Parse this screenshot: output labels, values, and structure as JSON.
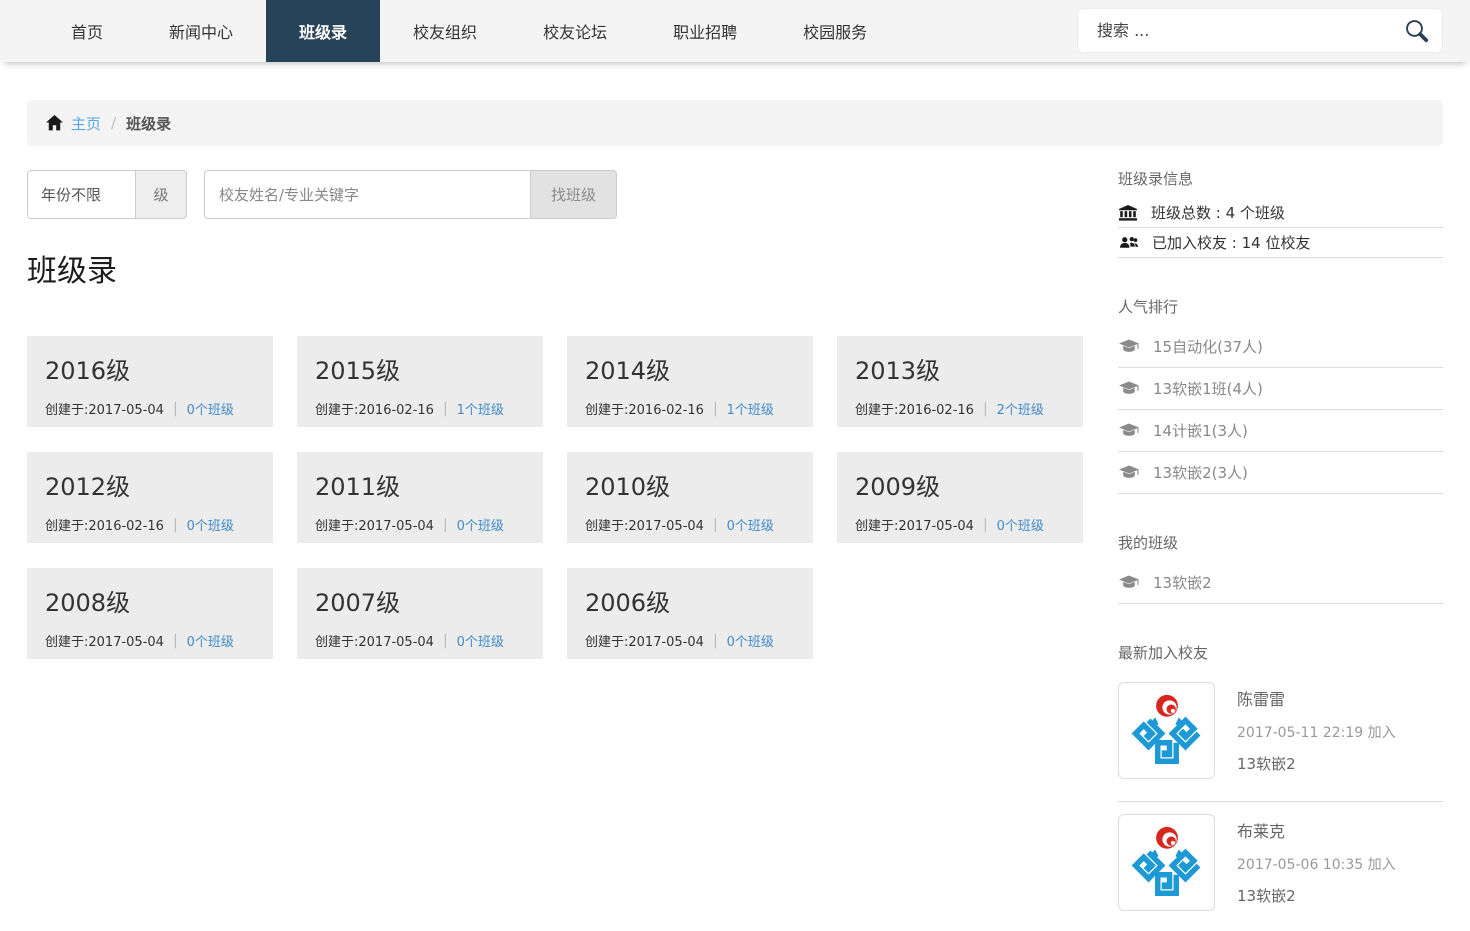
{
  "nav": {
    "items": [
      {
        "label": "首页",
        "active": false
      },
      {
        "label": "新闻中心",
        "active": false
      },
      {
        "label": "班级录",
        "active": true
      },
      {
        "label": "校友组织",
        "active": false
      },
      {
        "label": "校友论坛",
        "active": false
      },
      {
        "label": "职业招聘",
        "active": false
      },
      {
        "label": "校园服务",
        "active": false
      }
    ],
    "search_placeholder": "搜索 ...",
    "search_icon": "search-icon"
  },
  "breadcrumb": {
    "home_icon": "home-icon",
    "home": "主页",
    "separator": "/",
    "current": "班级录"
  },
  "filter": {
    "year_select": "年份不限",
    "year_suffix": "级",
    "keyword_placeholder": "校友姓名/专业关键字",
    "submit": "找班级"
  },
  "page_title": "班级录",
  "cards": [
    {
      "year": "2016级",
      "created": "创建于:2017-05-04",
      "sep": "|",
      "link": "0个班级"
    },
    {
      "year": "2015级",
      "created": "创建于:2016-02-16",
      "sep": "|",
      "link": "1个班级"
    },
    {
      "year": "2014级",
      "created": "创建于:2016-02-16",
      "sep": "|",
      "link": "1个班级"
    },
    {
      "year": "2013级",
      "created": "创建于:2016-02-16",
      "sep": "|",
      "link": "2个班级"
    },
    {
      "year": "2012级",
      "created": "创建于:2016-02-16",
      "sep": "|",
      "link": "0个班级"
    },
    {
      "year": "2011级",
      "created": "创建于:2017-05-04",
      "sep": "|",
      "link": "0个班级"
    },
    {
      "year": "2010级",
      "created": "创建于:2017-05-04",
      "sep": "|",
      "link": "0个班级"
    },
    {
      "year": "2009级",
      "created": "创建于:2017-05-04",
      "sep": "|",
      "link": "0个班级"
    },
    {
      "year": "2008级",
      "created": "创建于:2017-05-04",
      "sep": "|",
      "link": "0个班级"
    },
    {
      "year": "2007级",
      "created": "创建于:2017-05-04",
      "sep": "|",
      "link": "0个班级"
    },
    {
      "year": "2006级",
      "created": "创建于:2017-05-04",
      "sep": "|",
      "link": "0个班级"
    }
  ],
  "sidebar": {
    "info": {
      "title": "班级录信息",
      "rows": [
        {
          "icon": "bank-icon",
          "text": "班级总数 : 4 个班级"
        },
        {
          "icon": "users-icon",
          "text": "已加入校友 : 14 位校友"
        }
      ]
    },
    "ranking": {
      "title": "人气排行",
      "icon": "graduation-cap-icon",
      "items": [
        "15自动化(37人)",
        "13软嵌1班(4人)",
        "14计嵌1(3人)",
        "13软嵌2(3人)"
      ]
    },
    "my_classes": {
      "title": "我的班级",
      "icon": "graduation-cap-icon",
      "items": [
        "13软嵌2"
      ]
    },
    "newest": {
      "title": "最新加入校友",
      "avatar_icon": "school-logo-icon",
      "items": [
        {
          "name": "陈雷雷",
          "joined": "2017-05-11 22:19  加入",
          "class": "13软嵌2"
        },
        {
          "name": "布莱克",
          "joined": "2017-05-06 10:35  加入",
          "class": "13软嵌2"
        }
      ]
    }
  },
  "colors": {
    "active_tab": "#274357",
    "link_blue": "#428bca",
    "breadcrumb_link": "#58a6e8",
    "nav_bg": "#f4f4f4",
    "card_bg": "#ececec",
    "logo_blue": "#1d9ad6",
    "logo_red": "#d7261d"
  }
}
